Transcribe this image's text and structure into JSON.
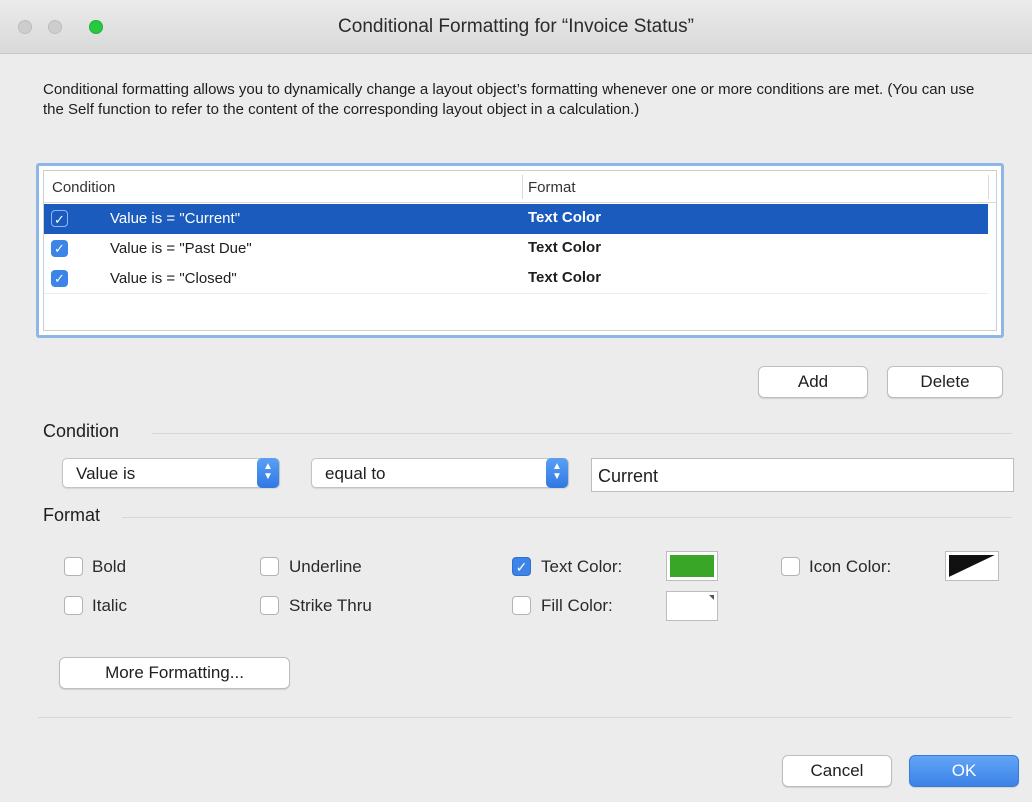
{
  "window": {
    "title": "Conditional Formatting for “Invoice Status”"
  },
  "description": "Conditional formatting allows you to dynamically change a layout object’s formatting whenever one or more conditions are met.  (You can use the Self function to refer to the content of the corresponding layout object in a calculation.)",
  "table": {
    "headers": {
      "condition": "Condition",
      "format": "Format"
    },
    "rows": [
      {
        "checked": true,
        "condition": "Value is = \"Current\"",
        "format": "Text Color",
        "selected": true
      },
      {
        "checked": true,
        "condition": "Value is = \"Past Due\"",
        "format": "Text Color",
        "selected": false
      },
      {
        "checked": true,
        "condition": "Value is = \"Closed\"",
        "format": "Text Color",
        "selected": false
      }
    ]
  },
  "buttons": {
    "add": "Add",
    "delete": "Delete",
    "more": "More Formatting...",
    "cancel": "Cancel",
    "ok": "OK"
  },
  "condition_section": {
    "heading": "Condition",
    "type_select": "Value is",
    "operator_select": "equal to",
    "value": "Current"
  },
  "format_section": {
    "heading": "Format",
    "bold": {
      "label": "Bold",
      "checked": false
    },
    "italic": {
      "label": "Italic",
      "checked": false
    },
    "underline": {
      "label": "Underline",
      "checked": false
    },
    "strike": {
      "label": "Strike Thru",
      "checked": false
    },
    "text_color": {
      "label": "Text Color:",
      "checked": true,
      "color": "#3aa628"
    },
    "fill_color": {
      "label": "Fill Color:",
      "checked": false
    },
    "icon_color": {
      "label": "Icon Color:",
      "checked": false
    }
  },
  "colors": {
    "accent": "#3d84e8",
    "selection": "#1a5bbd",
    "zoom": "#28c940"
  }
}
